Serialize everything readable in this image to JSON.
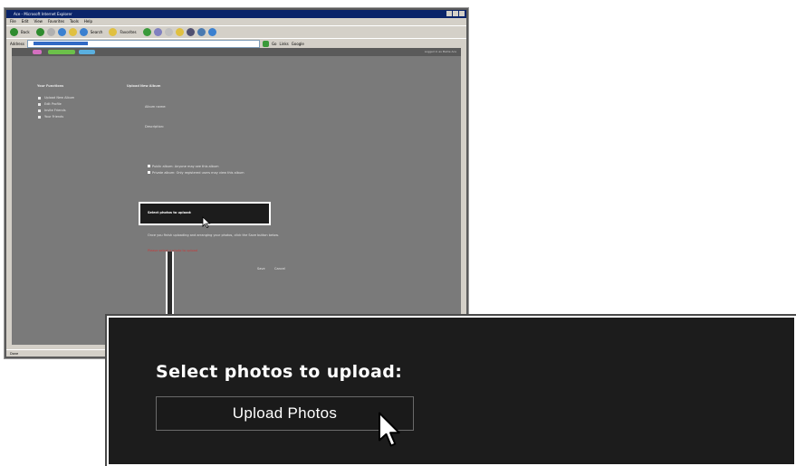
{
  "browser": {
    "title": "Ace - Microsoft Internet Explorer",
    "menu": [
      "File",
      "Edit",
      "View",
      "Favorites",
      "Tools",
      "Help"
    ],
    "toolbar": {
      "back": "Back",
      "search": "Search",
      "favorites": "Favorites"
    },
    "address_label": "Address",
    "go_label": "Go",
    "links_label": "Links",
    "google_label": "Google",
    "status": "Done"
  },
  "site": {
    "tabs": [
      "Home",
      "Edit Albums",
      "Logout"
    ],
    "signed_in": "Logged in as Mellie Ace",
    "sidebar": {
      "title": "Your Functions",
      "items": [
        "Upload New Album",
        "Edit Profile",
        "Invite Friends",
        "Your Friends"
      ]
    },
    "form": {
      "title": "Upload New Album",
      "album_name_label": "Album name:",
      "description_label": "Description:",
      "public_option": "Public album: Anyone may see this album",
      "private_option": "Private album: Only registered users may view this album",
      "select_label": "Select photos to upload:",
      "upload_button": "Upload Photos",
      "help_text": "Once you finish uploading and arranging your photos, click the Save button below.",
      "error_text": "Please select a photo to upload",
      "save": "Save",
      "cancel": "Cancel"
    }
  },
  "callout": {
    "select_label": "Select photos to upload:",
    "upload_button": "Upload Photos"
  },
  "colors": {
    "page_gray": "#7a7a7a",
    "callout_bg": "#1c1c1c",
    "title_blue": "#0a246a",
    "tab_pink": "#d470c0",
    "tab_green": "#6cc04a",
    "tab_blue": "#5ab0e0",
    "error_red": "#c83a3a"
  }
}
